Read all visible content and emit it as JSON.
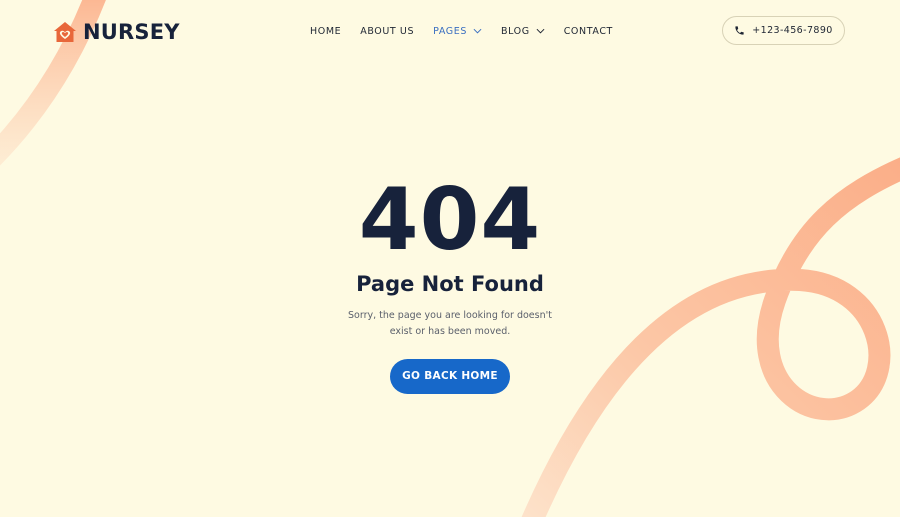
{
  "brand": {
    "name": "NURSEY",
    "accent_color": "#e8673a",
    "icon": "house-heart-icon"
  },
  "nav": {
    "items": [
      {
        "label": "HOME",
        "has_dropdown": false,
        "active": false
      },
      {
        "label": "ABOUT US",
        "has_dropdown": false,
        "active": false
      },
      {
        "label": "PAGES",
        "has_dropdown": true,
        "active": true
      },
      {
        "label": "BLOG",
        "has_dropdown": true,
        "active": false
      },
      {
        "label": "CONTACT",
        "has_dropdown": false,
        "active": false
      }
    ],
    "active_color": "#3a6fc1"
  },
  "contact": {
    "phone": "+123-456-7890",
    "icon": "phone-icon"
  },
  "error": {
    "code": "404",
    "title": "Page Not Found",
    "message": "Sorry, the page you are looking for doesn't exist or has been moved.",
    "button_label": "GO BACK HOME"
  },
  "colors": {
    "background": "#fefae2",
    "text_dark": "#17223b",
    "button": "#1768c9",
    "swirl": "#fdb892"
  }
}
